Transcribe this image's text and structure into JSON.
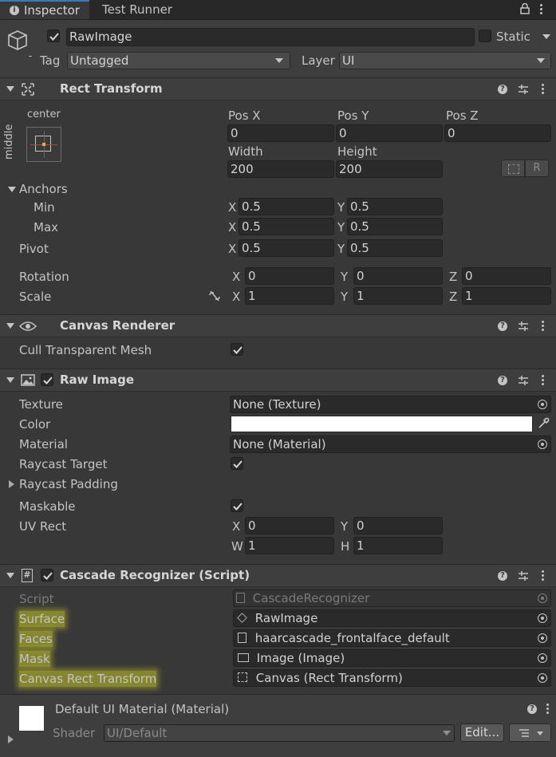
{
  "tabs": {
    "inspector": "Inspector",
    "test_runner": "Test Runner"
  },
  "gameobject": {
    "name": "RawImage",
    "static_label": "Static",
    "tag_label": "Tag",
    "tag_value": "Untagged",
    "layer_label": "Layer",
    "layer_value": "UI"
  },
  "rect_transform": {
    "title": "Rect Transform",
    "anchor_h": "center",
    "anchor_v": "middle",
    "pos_x_label": "Pos X",
    "pos_y_label": "Pos Y",
    "pos_z_label": "Pos Z",
    "pos_x": "0",
    "pos_y": "0",
    "pos_z": "0",
    "width_label": "Width",
    "height_label": "Height",
    "width": "200",
    "height": "200",
    "r_button": "R",
    "anchors_label": "Anchors",
    "min_label": "Min",
    "max_label": "Max",
    "min_x": "0.5",
    "min_y": "0.5",
    "max_x": "0.5",
    "max_y": "0.5",
    "pivot_label": "Pivot",
    "pivot_x": "0.5",
    "pivot_y": "0.5",
    "rotation_label": "Rotation",
    "rot_x": "0",
    "rot_y": "0",
    "rot_z": "0",
    "scale_label": "Scale",
    "scale_x": "1",
    "scale_y": "1",
    "scale_z": "1",
    "x": "X",
    "y": "Y",
    "z": "Z"
  },
  "canvas_renderer": {
    "title": "Canvas Renderer",
    "cull_label": "Cull Transparent Mesh"
  },
  "raw_image": {
    "title": "Raw Image",
    "texture_label": "Texture",
    "texture_value": "None (Texture)",
    "color_label": "Color",
    "color_value": "#ffffff",
    "material_label": "Material",
    "material_value": "None (Material)",
    "raycast_target_label": "Raycast Target",
    "raycast_padding_label": "Raycast Padding",
    "maskable_label": "Maskable",
    "uv_rect_label": "UV Rect",
    "uv_x": "0",
    "uv_y": "0",
    "uv_w": "1",
    "uv_h": "1",
    "w": "W",
    "h": "H"
  },
  "cascade": {
    "title": "Cascade Recognizer (Script)",
    "script_label": "Script",
    "script_value": "CascadeRecognizer",
    "surface_label": "Surface",
    "surface_value": "RawImage",
    "faces_label": "Faces",
    "faces_value": "haarcascade_frontalface_default",
    "mask_label": "Mask",
    "mask_value": "Image (Image)",
    "canvas_label": "Canvas Rect Transform",
    "canvas_value": "Canvas (Rect Transform)"
  },
  "material": {
    "title": "Default UI Material (Material)",
    "shader_label": "Shader",
    "shader_value": "UI/Default",
    "edit_button": "Edit..."
  },
  "colors": {
    "highlight": "#e6e628",
    "panel": "#383838",
    "header": "#3e3e3e",
    "field": "#2a2a2a"
  }
}
